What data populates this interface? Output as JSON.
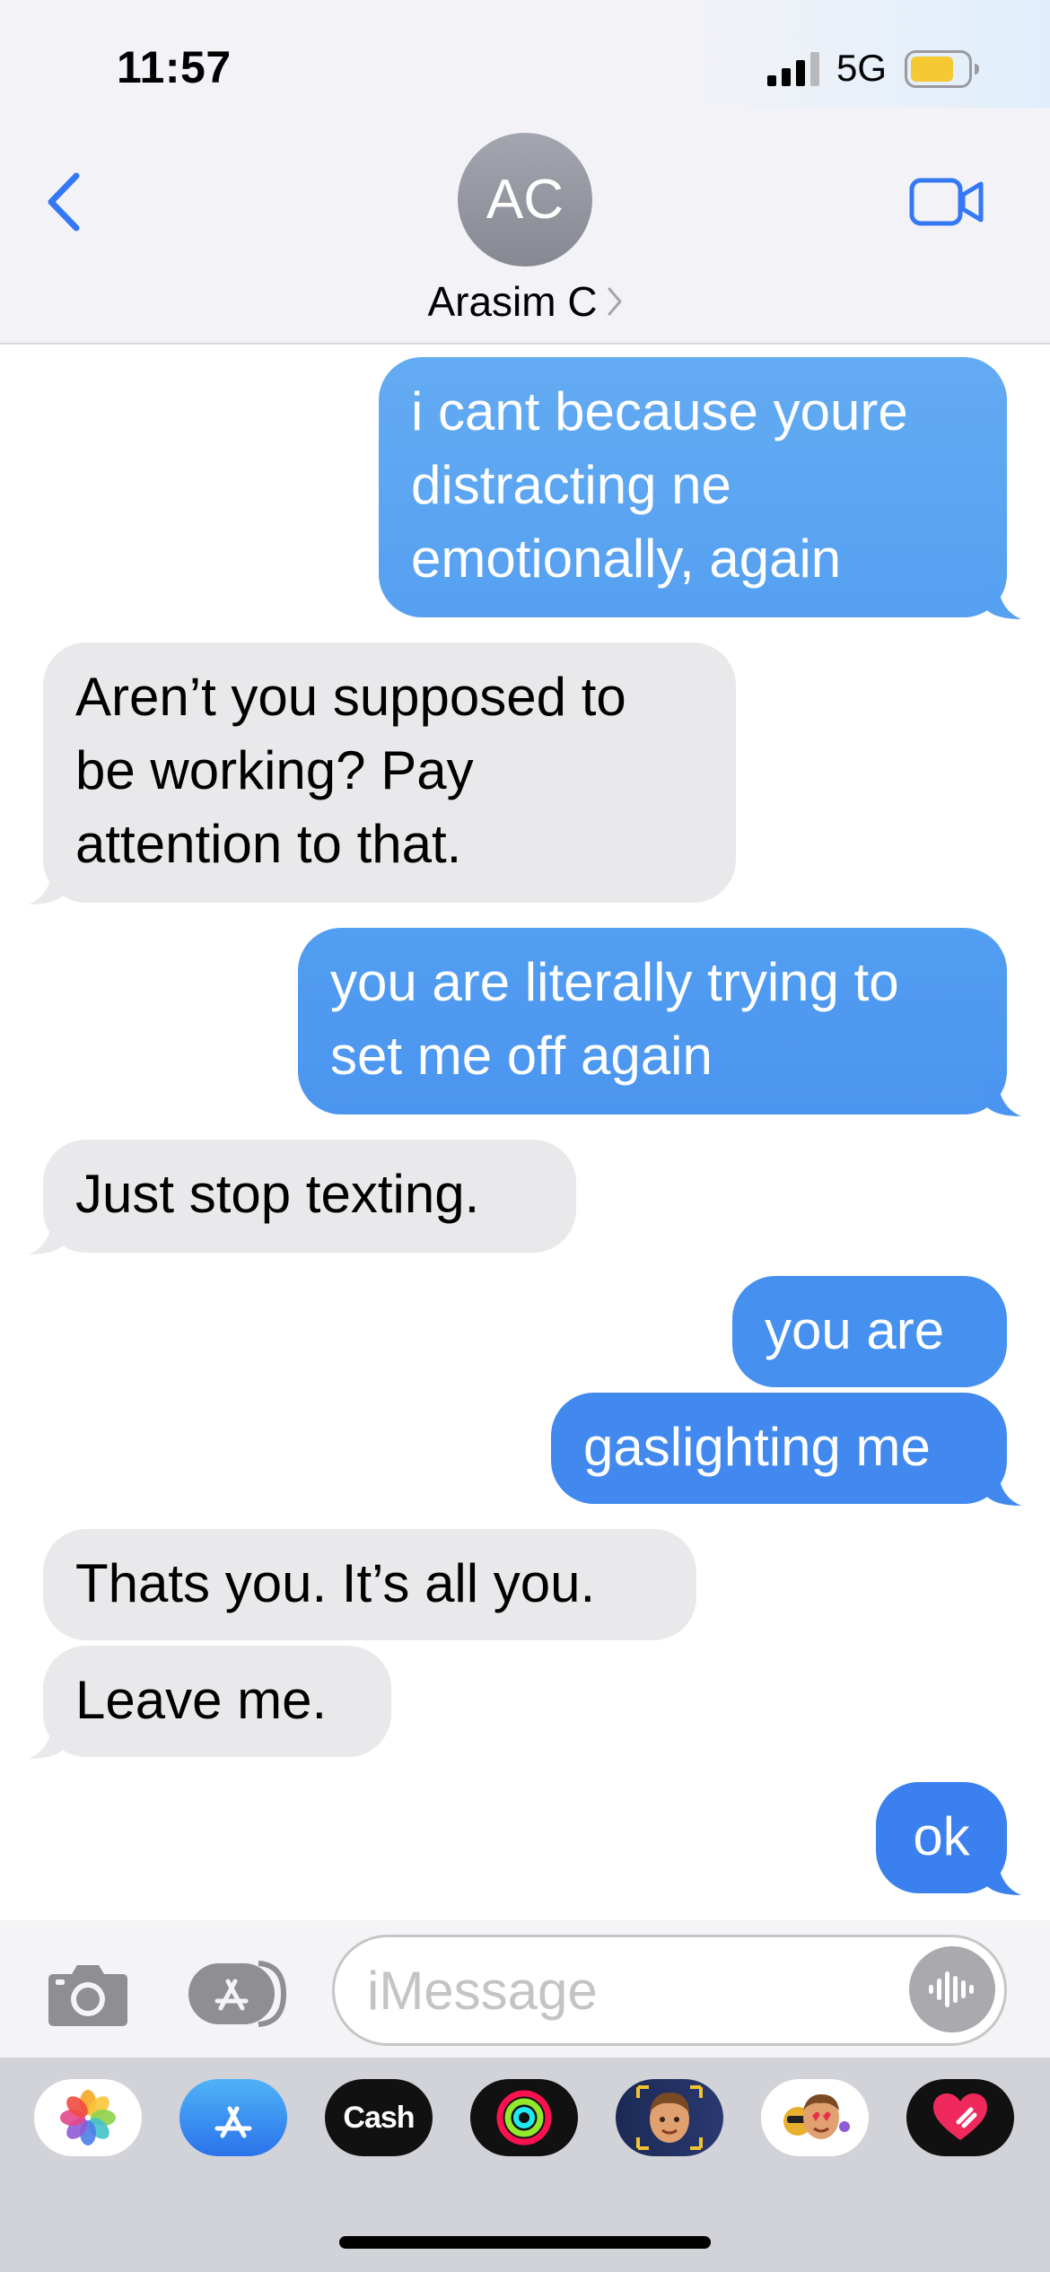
{
  "status_bar": {
    "time": "11:57",
    "network": "5G",
    "signal_icon": "cellular-signal-icon",
    "battery_icon": "battery-icon"
  },
  "header": {
    "back_icon": "chevron-left-icon",
    "avatar_initials": "AC",
    "contact_name": "Arasim C",
    "video_icon": "video-camera-icon"
  },
  "colors": {
    "accent": "#3478f6",
    "sent_bubble_top": "#63abf2",
    "sent_bubble_bottom": "#3a80ef",
    "received_bubble": "#e9e9eb",
    "header_bg": "#f2f2f7",
    "drawer_bg": "#d1d3d9"
  },
  "messages": [
    {
      "direction": "sent",
      "text": "i cant because youre\ndistracting ne\nemotionally, again"
    },
    {
      "direction": "received",
      "text": "Aren’t you supposed to\nbe working? Pay\nattention to that."
    },
    {
      "direction": "sent",
      "text": "you are literally trying to\nset me off again"
    },
    {
      "direction": "received",
      "text": "Just stop texting."
    },
    {
      "direction": "sent",
      "text": "you are"
    },
    {
      "direction": "sent",
      "text": "gaslighting me"
    },
    {
      "direction": "received",
      "text": "Thats you.  It’s all you."
    },
    {
      "direction": "received",
      "text": "Leave me."
    },
    {
      "direction": "sent",
      "text": "ok"
    }
  ],
  "input_bar": {
    "camera_icon": "camera-icon",
    "apps_icon": "app-store-icon",
    "placeholder": "iMessage",
    "voice_icon": "waveform-icon"
  },
  "app_drawer": {
    "apps": [
      {
        "name": "photos-app-icon"
      },
      {
        "name": "app-store-app-icon"
      },
      {
        "name": "apple-cash-app-icon",
        "label": "Cash"
      },
      {
        "name": "activity-app-icon"
      },
      {
        "name": "memoji-app-icon"
      },
      {
        "name": "memoji-stickers-app-icon"
      },
      {
        "name": "digital-touch-app-icon"
      }
    ]
  }
}
